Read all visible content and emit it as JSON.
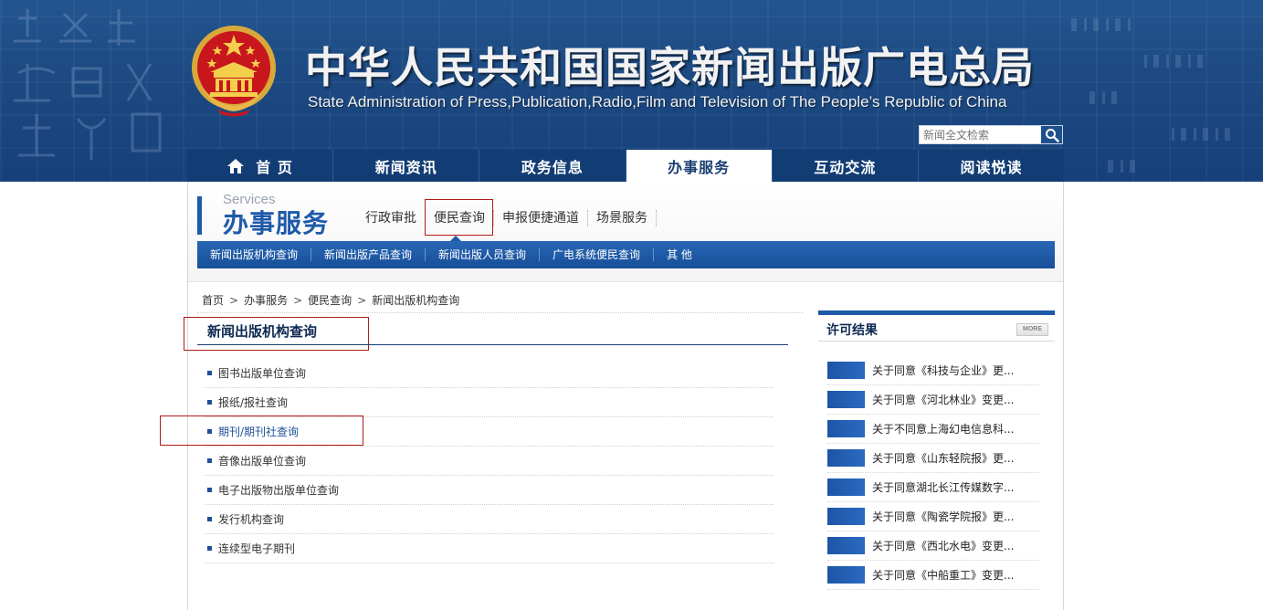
{
  "header": {
    "title": "中华人民共和国国家新闻出版广电总局",
    "subtitle": "State Administration of Press,Publication,Radio,Film and Television of The People’s Republic of China",
    "emblem_icon": "national-emblem-icon",
    "search": {
      "placeholder": "新闻全文检索",
      "button_icon": "search-icon"
    }
  },
  "mainnav": {
    "items": [
      {
        "label": "首 页",
        "icon": "home-icon"
      },
      {
        "label": "新闻资讯"
      },
      {
        "label": "政务信息"
      },
      {
        "label": "办事服务",
        "active": true
      },
      {
        "label": "互动交流"
      },
      {
        "label": "阅读悦读"
      }
    ]
  },
  "section": {
    "en": "Services",
    "cn": "办事服务",
    "subnav": [
      "行政审批",
      "便民查询",
      "申报便捷通道",
      "场景服务"
    ],
    "bluebar": [
      "新闻出版机构查询",
      "新闻出版产品查询",
      "新闻出版人员查询",
      "广电系统便民查询",
      "其  他"
    ]
  },
  "breadcrumb": [
    "首页",
    "办事服务",
    "便民查询",
    "新闻出版机构查询"
  ],
  "breadcrumb_sep": ">",
  "list": {
    "title": "新闻出版机构查询",
    "items": [
      "图书出版单位查询",
      "报纸/报社查询",
      "期刊/期刊社查询",
      "音像出版单位查询",
      "电子出版物出版单位查询",
      "发行机构查询",
      "连续型电子期刊"
    ]
  },
  "right_panel": {
    "title": "许可结果",
    "more": "MORE",
    "items": [
      "关于同意《科技与企业》更...",
      "关于同意《河北林业》变更...",
      "关于不同意上海幻电信息科...",
      "关于同意《山东轻院报》更...",
      "关于同意湖北长江传媒数字...",
      "关于同意《陶瓷学院报》更...",
      "关于同意《西北水电》变更...",
      "关于同意《中船重工》变更..."
    ]
  },
  "colors": {
    "accent": "#1e5aa8",
    "nav_bg": "#123d74",
    "highlight_box": "#b01b1b"
  }
}
